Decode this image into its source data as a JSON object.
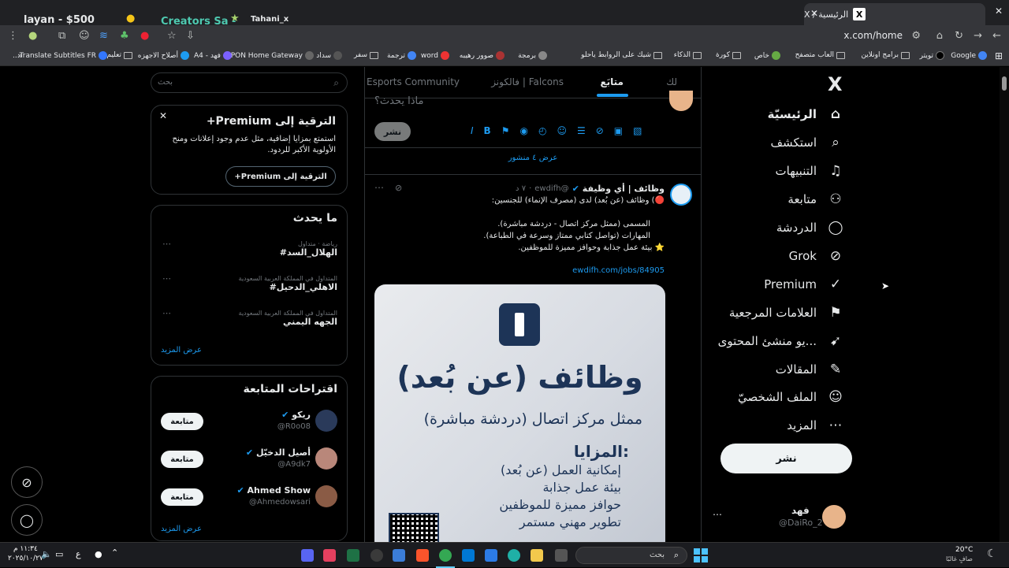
{
  "browser": {
    "tab_title": "الرئيسية / X",
    "tab_icon": "X",
    "url": "x.com/home",
    "overlay_items": [
      "layan - $500",
      "Creators Sa -",
      "Tahani_x"
    ],
    "bookmarks": [
      "Google",
      "تويتر",
      "برامج اونلاين",
      "العاب متصفح",
      "خاص",
      "كورة",
      "الذكاء",
      "شيك على الروابط ياحلو",
      "برمجة",
      "صوور رهيبه",
      "word",
      "ترجمة",
      "سفر",
      "سداد",
      "GPON Home Gateway",
      "فهد - A4",
      "أصلاح الاجهزه",
      "تعليم",
      "Translate Subtitles FR..."
    ]
  },
  "sidebar": {
    "logo": "X",
    "items": [
      {
        "label": "الرئيسيّة",
        "icon": "home-icon",
        "glyph": "⌂"
      },
      {
        "label": "استكشف",
        "icon": "search-icon",
        "glyph": "⌕"
      },
      {
        "label": "التنبيهات",
        "icon": "bell-icon",
        "glyph": "♫"
      },
      {
        "label": "متابعة",
        "icon": "follow-icon",
        "glyph": "⚇"
      },
      {
        "label": "الدردشة",
        "icon": "chat-icon",
        "glyph": "◯"
      },
      {
        "label": "Grok",
        "icon": "grok-icon",
        "glyph": "⊘"
      },
      {
        "label": "Premium",
        "icon": "premium-icon",
        "glyph": "✓"
      },
      {
        "label": "العلامات المرجعية",
        "icon": "bookmark-icon",
        "glyph": "⚑"
      },
      {
        "label": "...يو منشئ المحتوى",
        "icon": "rocket-icon",
        "glyph": "➹"
      },
      {
        "label": "المقالات",
        "icon": "articles-icon",
        "glyph": "✎"
      },
      {
        "label": "الملف الشخصيّ",
        "icon": "profile-icon",
        "glyph": "☺"
      },
      {
        "label": "المزيد",
        "icon": "more-icon",
        "glyph": "⋯"
      }
    ],
    "post_label": "نشر",
    "account": {
      "name": "فهد",
      "handle": "@DaiRo_2"
    }
  },
  "timeline": {
    "tabs": [
      "لك",
      "متابَع",
      "فالكونز | Falcons",
      "Esports Community"
    ],
    "compose_placeholder": "ماذا يحدث؟",
    "compose_button": "نشر",
    "show_posts": "عرض ٤ منشور",
    "tweet": {
      "author": "وظائف | أي وظيفة",
      "handle": "@ewdifh",
      "time": "٧ د",
      "line1": "🔴) وظائف (عن بُعد) لدى (مصرف الإنماء) للجنسين:",
      "bullets": [
        "المسمى (ممثل مركز اتصال - دردشة مباشرة).",
        "المهارات (تواصل كتابي ممتاز وسرعة في الطباعة).",
        "⭐ بيئة عمل جذابة وحوافز مميزة للموظفين."
      ],
      "link": "ewdifh.com/jobs/84905",
      "image": {
        "headline": "وظائف (عن بُعد)",
        "sub": "ممثل مركز اتصال (دردشة مباشرة)",
        "benefits_title": "المزايا:",
        "benefits": [
          "إمكانية العمل (عن بُعد)",
          "بيئة عمل جذابة",
          "حوافز مميزة للموظفين",
          "تطوير مهني مستمر"
        ]
      }
    }
  },
  "right": {
    "search_placeholder": "بحث",
    "premium": {
      "title": "+Premium الترقية إلى",
      "body": "استمتع بمزايا إضافية، مثل عدم وجود إعلانات ومنح الأولوية الأكبر للردود.",
      "button": "+Premium الترقية إلى"
    },
    "trends": {
      "title": "ما يحدث",
      "items": [
        {
          "meta": "رياضة · متداول",
          "name": "#الهلال_السد"
        },
        {
          "meta": "المتداول في المملكة العربية السعودية",
          "name": "#الاهلي_الدحيل"
        },
        {
          "meta": "المتداول في المملكة العربية السعودية",
          "name": "الجهه اليمني"
        }
      ],
      "more": "عرض المزيد"
    },
    "who_to_follow": {
      "title": "اقتراحات المتابعة",
      "items": [
        {
          "name": "ريكو",
          "handle": "@R0o08",
          "button": "متابعة"
        },
        {
          "name": "أصيل الدخيّل",
          "handle": "@A9dk7",
          "button": "متابعة"
        },
        {
          "name": "Ahmed Show",
          "handle": "@Ahmedowsari",
          "button": "متابعة"
        }
      ],
      "more": "عرض المزيد"
    }
  },
  "taskbar": {
    "search": "بحث",
    "time": "١١:٣٤ م",
    "date": "٢٠٢٥/١٠/٢٧",
    "lang": "ع",
    "weather_temp": "20°C",
    "weather_desc": "صافٍ غالبًا"
  },
  "colors": {
    "accent": "#1d9bf0",
    "bg": "#000000",
    "border": "#2f3336"
  }
}
